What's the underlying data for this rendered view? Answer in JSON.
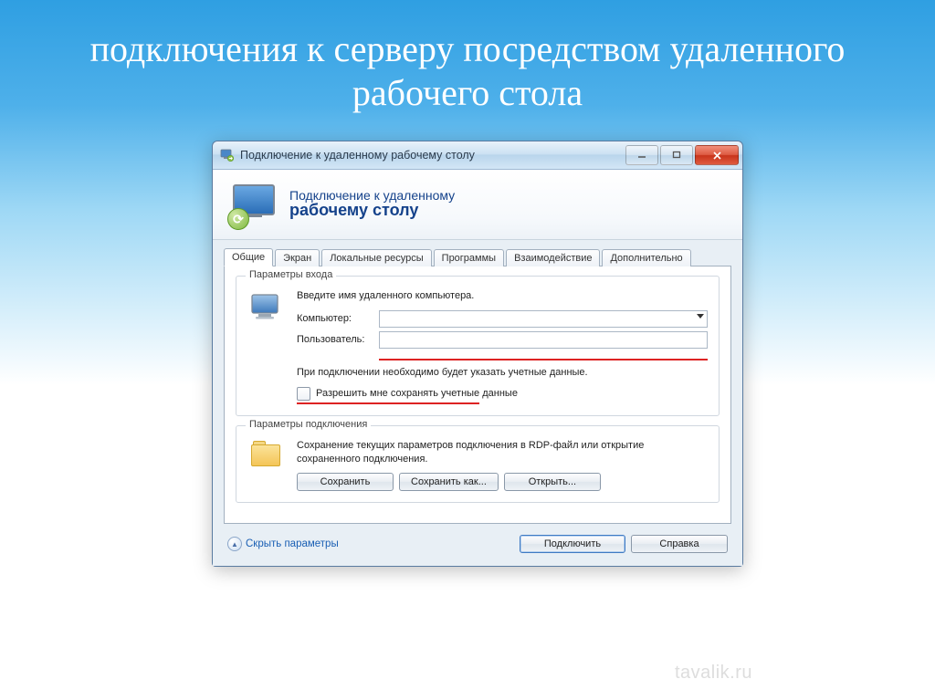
{
  "slide": {
    "title": "подключения к серверу посредством удаленного рабочего стола"
  },
  "titlebar": {
    "text": "Подключение к удаленному рабочему столу"
  },
  "header": {
    "line1": "Подключение к удаленному",
    "line2": "рабочему столу"
  },
  "tabs": [
    {
      "label": "Общие",
      "active": true
    },
    {
      "label": "Экран",
      "active": false
    },
    {
      "label": "Локальные ресурсы",
      "active": false
    },
    {
      "label": "Программы",
      "active": false
    },
    {
      "label": "Взаимодействие",
      "active": false
    },
    {
      "label": "Дополнительно",
      "active": false
    }
  ],
  "group_login": {
    "title": "Параметры входа",
    "instruction": "Введите имя удаленного компьютера.",
    "computer_label": "Компьютер:",
    "computer_value": "",
    "user_label": "Пользователь:",
    "user_value": "",
    "note": "При подключении необходимо будет указать учетные данные.",
    "checkbox_label": "Разрешить мне сохранять учетные данные"
  },
  "group_conn": {
    "title": "Параметры подключения",
    "desc": "Сохранение текущих параметров подключения в RDP-файл или открытие сохраненного подключения.",
    "save": "Сохранить",
    "save_as": "Сохранить как...",
    "open": "Открыть..."
  },
  "footer": {
    "hide_options": "Скрыть параметры",
    "connect": "Подключить",
    "help": "Справка"
  },
  "watermark": "tavalik.ru"
}
